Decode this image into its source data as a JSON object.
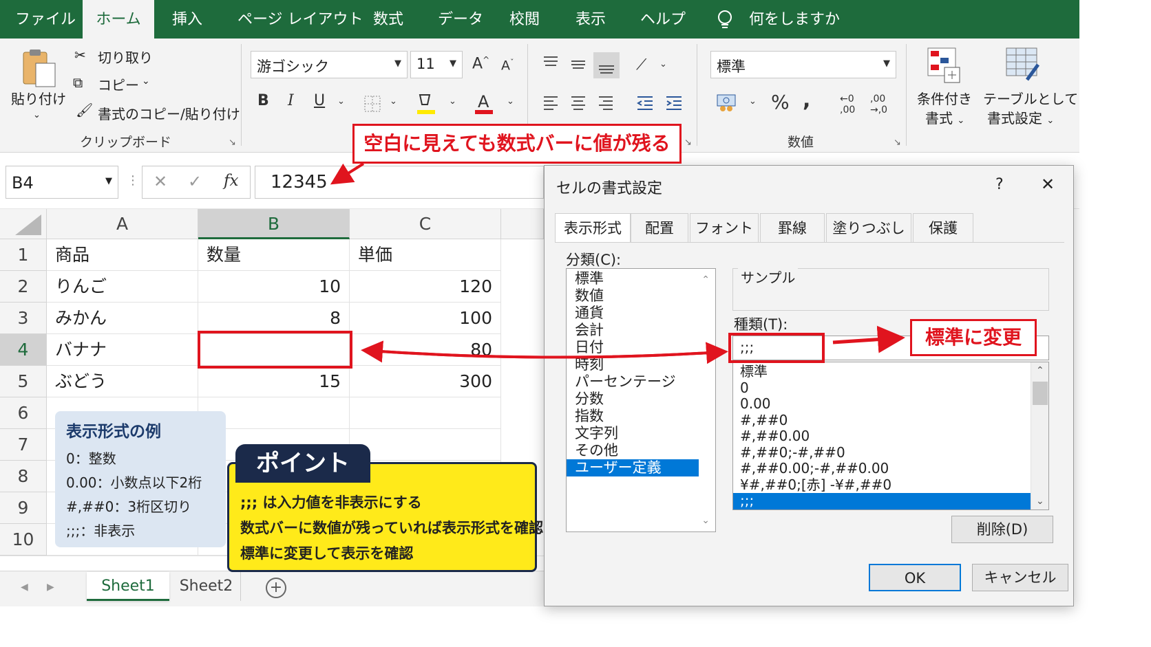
{
  "ribbon_tabs": [
    "ファイル",
    "ホーム",
    "挿入",
    "ページ レイアウト",
    "数式",
    "データ",
    "校閲",
    "表示",
    "ヘルプ"
  ],
  "tell_me": "何をしますか",
  "clipboard": {
    "paste": "貼り付け",
    "cut": "切り取り",
    "copy": "コピー",
    "format_painter": "書式のコピー/貼り付け",
    "group": "クリップボード"
  },
  "font": {
    "name": "游ゴシック",
    "size": "11",
    "bold": "B",
    "italic": "I",
    "underline": "U",
    "grow": "A",
    "shrink": "A"
  },
  "number": {
    "format": "標準",
    "percent": "%",
    "comma": ",",
    "inc_decimal_top": "←0",
    "inc_decimal_bottom": ",00",
    "dec_decimal_top": ",00",
    "dec_decimal_bottom": "→,0",
    "group": "数値"
  },
  "styles": {
    "conditional_1": "条件付き",
    "conditional_2": "書式",
    "table_1": "テーブルとして",
    "table_2": "書式設定"
  },
  "formula_bar": {
    "name_box": "B4",
    "fx": "fx",
    "cancel": "✕",
    "enter": "✓",
    "value": "12345"
  },
  "callout_top": "空白に見えても数式バーに値が残る",
  "callout_right": "標準に変更",
  "sheet": {
    "columns": [
      "A",
      "B",
      "C"
    ],
    "rows": [
      {
        "num": "1",
        "a": "商品",
        "b": "数量",
        "c": "単価"
      },
      {
        "num": "2",
        "a": "りんご",
        "b": "10",
        "c": "120"
      },
      {
        "num": "3",
        "a": "みかん",
        "b": "8",
        "c": "100"
      },
      {
        "num": "4",
        "a": "バナナ",
        "b": "",
        "c": "80"
      },
      {
        "num": "5",
        "a": "ぶどう",
        "b": "15",
        "c": "300"
      },
      {
        "num": "6",
        "a": "",
        "b": "",
        "c": ""
      },
      {
        "num": "7",
        "a": "",
        "b": "",
        "c": ""
      },
      {
        "num": "8",
        "a": "",
        "b": "",
        "c": ""
      },
      {
        "num": "9",
        "a": "",
        "b": "",
        "c": ""
      },
      {
        "num": "10",
        "a": "",
        "b": "",
        "c": ""
      }
    ],
    "tabs": [
      "Sheet1",
      "Sheet2"
    ],
    "add_sheet": "+"
  },
  "info_box": {
    "title": "表示形式の例",
    "lines": [
      "0：整数",
      "0.00：小数点以下2桁",
      "#,##0：3桁区切り",
      ";;;：非表示"
    ]
  },
  "point_box": {
    "tag": "ポイント",
    "lines": [
      ";;; は入力値を非表示にする",
      "数式バーに数値が残っていれば表示形式を確認",
      "標準に変更して表示を確認"
    ]
  },
  "dialog": {
    "title": "セルの書式設定",
    "help": "?",
    "close": "✕",
    "tabs": [
      "表示形式",
      "配置",
      "フォント",
      "罫線",
      "塗りつぶし",
      "保護"
    ],
    "category_label": "分類(C):",
    "categories": [
      "標準",
      "数値",
      "通貨",
      "会計",
      "日付",
      "時刻",
      "パーセンテージ",
      "分数",
      "指数",
      "文字列",
      "その他",
      "ユーザー定義"
    ],
    "sample_label": "サンプル",
    "type_label": "種類(T):",
    "type_value": ";;;",
    "formats": [
      "標準",
      "0",
      "0.00",
      "#,##0",
      "#,##0.00",
      "#,##0;-#,##0",
      "#,##0.00;-#,##0.00",
      "¥#,##0;[赤] -¥#,##0",
      ";;;"
    ],
    "delete": "削除(D)",
    "ok": "OK",
    "cancel": "キャンセル"
  },
  "colors": {
    "excel_green": "#1e6b3c",
    "highlight_red": "#e0141e",
    "selection_blue": "#0078d7",
    "point_yellow": "#ffea1a",
    "point_navy": "#1b2a4a",
    "info_blue": "#dce6f2"
  }
}
